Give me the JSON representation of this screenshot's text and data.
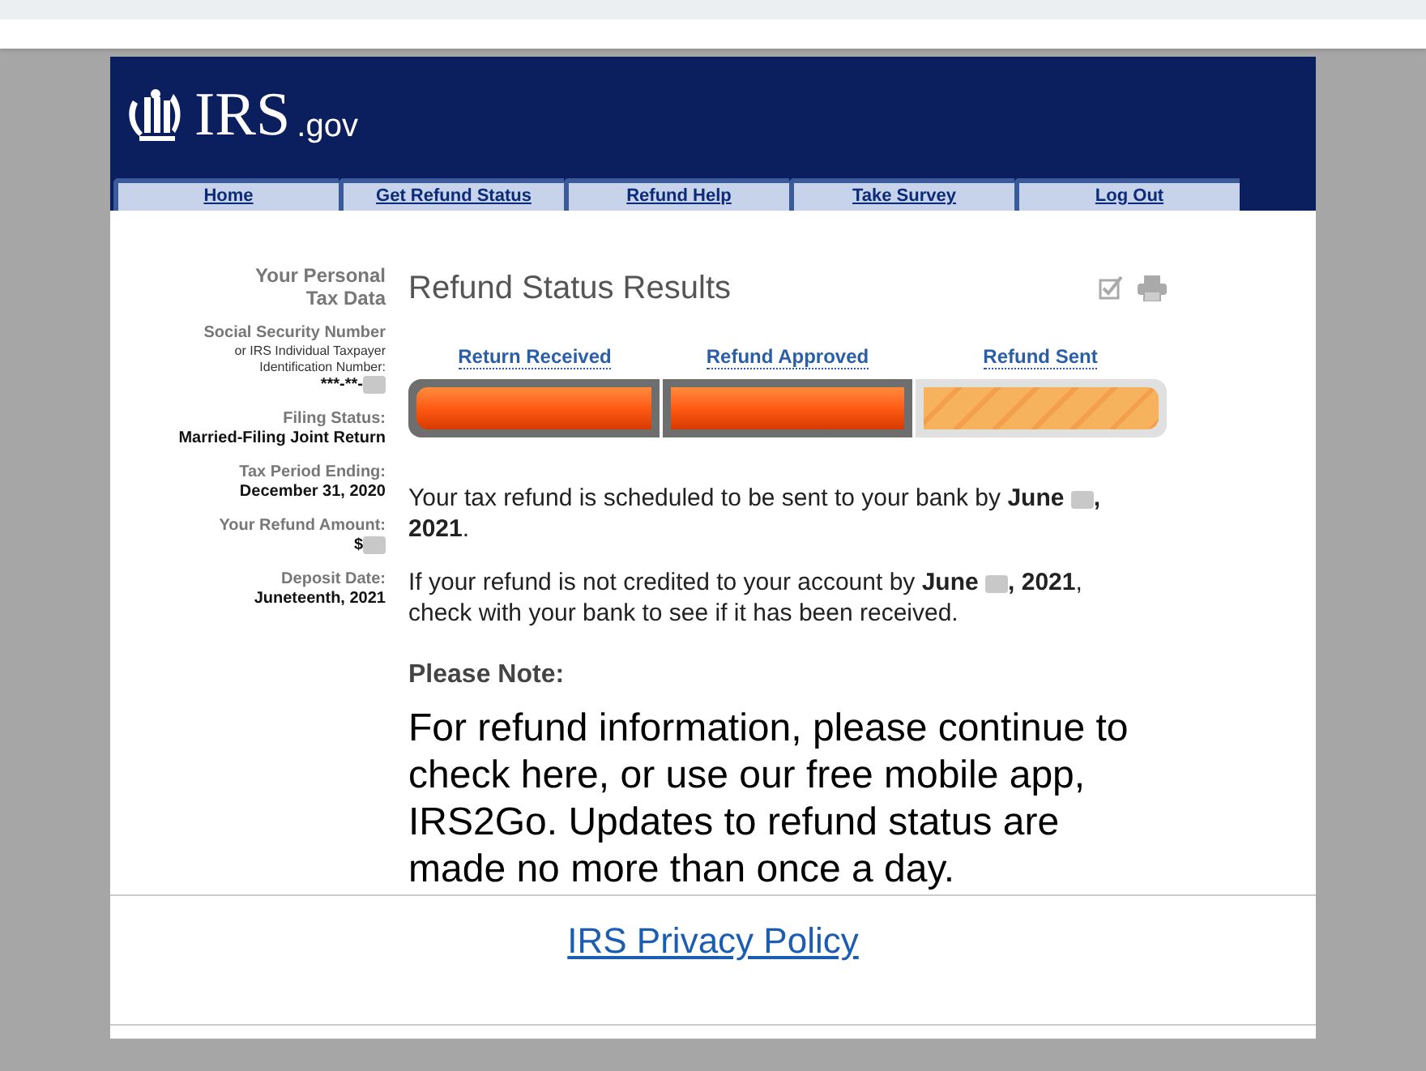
{
  "header": {
    "logo_text": "IRS",
    "logo_suffix": ".gov"
  },
  "nav_tabs": [
    {
      "label": "Home"
    },
    {
      "label": "Get Refund Status"
    },
    {
      "label": "Refund Help"
    },
    {
      "label": "Take Survey"
    },
    {
      "label": "Log Out"
    }
  ],
  "sidebar": {
    "title": "Your Personal Tax Data",
    "fields": [
      {
        "label": "Social Security Number",
        "sublabel": "or IRS Individual Taxpayer Identification Number:",
        "value": [
          {
            "kind": "text",
            "text": "***-**-"
          },
          {
            "kind": "redaction"
          }
        ]
      },
      {
        "label": "Filing Status:",
        "value": [
          {
            "kind": "text",
            "text": "Married-Filing Joint Return"
          }
        ]
      },
      {
        "label": "Tax Period Ending:",
        "value": [
          {
            "kind": "text",
            "text": "December 31, 2020"
          }
        ]
      },
      {
        "label": "Your Refund Amount:",
        "value": [
          {
            "kind": "text",
            "text": "$"
          },
          {
            "kind": "redaction"
          }
        ]
      },
      {
        "label": "Deposit Date:",
        "value": [
          {
            "kind": "text",
            "text": "Juneteenth, 2021"
          }
        ]
      }
    ]
  },
  "main": {
    "title": "Refund Status Results",
    "steps": [
      {
        "label": "Return Received",
        "done": true
      },
      {
        "label": "Refund Approved",
        "done": true
      },
      {
        "label": "Refund Sent",
        "done": false
      }
    ],
    "paragraphs": [
      [
        {
          "kind": "rich",
          "text": "Your tax refund is scheduled to be sent to your bank by **June** "
        },
        {
          "kind": "redaction"
        },
        {
          "kind": "rich",
          "text": "**, 2021**."
        }
      ],
      [
        {
          "kind": "rich",
          "text": "If your refund is not credited to your account by **June** "
        },
        {
          "kind": "redaction"
        },
        {
          "kind": "rich",
          "text": "**, 2021**, check with your bank to see if it has been received."
        }
      ]
    ],
    "note_heading": "Please Note:",
    "note_text": "For refund information, please continue to check here, or use our free mobile app, IRS2Go. Updates to refund status are made no more than once a day."
  },
  "footer": {
    "link": "IRS Privacy Policy"
  }
}
